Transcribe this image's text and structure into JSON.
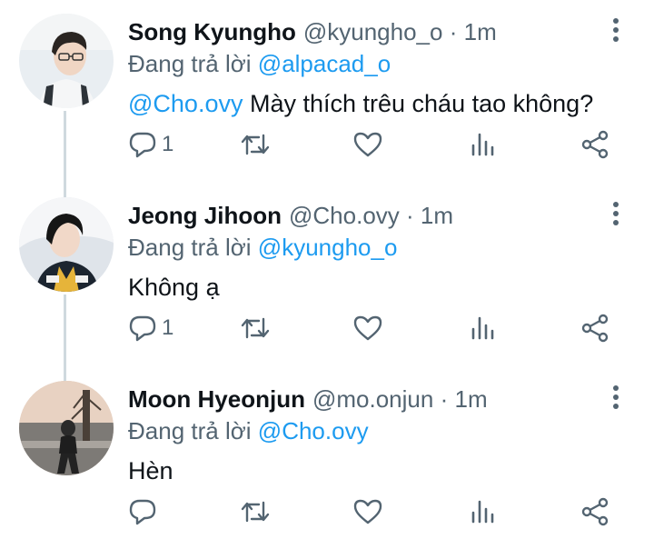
{
  "colors": {
    "accent": "#1d9bf0",
    "secondary_text": "#536471",
    "primary_text": "#0f1419",
    "connector": "#cfd9de"
  },
  "reply_prefix": "Đang trả lời",
  "separator": "·",
  "icons": {
    "reply": "reply-icon",
    "retweet": "retweet-icon",
    "like": "heart-icon",
    "stats": "analytics-icon",
    "share": "share-icon",
    "more": "more-options-icon"
  },
  "tweets": [
    {
      "name": "Song Kyungho",
      "handle": "@kyungho_o",
      "time": "1m",
      "reply_to": "@alpacad_o",
      "mention": "@Cho.ovy",
      "text": " Mày thích trêu cháu tao không?",
      "reply_count": "1"
    },
    {
      "name": "Jeong Jihoon",
      "handle": "@Cho.ovy",
      "time": "1m",
      "reply_to": "@kyungho_o",
      "mention": "",
      "text": "Không ạ",
      "reply_count": "1"
    },
    {
      "name": "Moon Hyeonjun",
      "handle": "@mo.onjun",
      "time": "1m",
      "reply_to": "@Cho.ovy",
      "mention": "",
      "text": "Hèn",
      "reply_count": ""
    }
  ]
}
